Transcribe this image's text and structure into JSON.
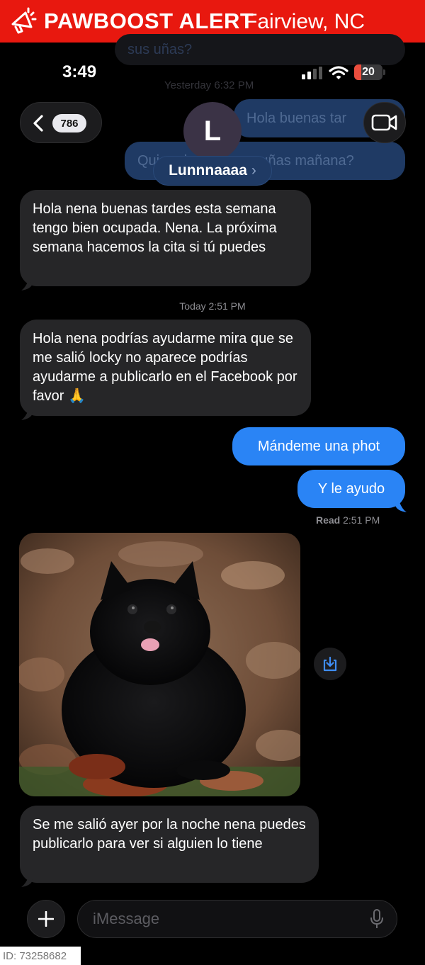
{
  "banner": {
    "brand": "PAWBOOST ALERT",
    "location": "Fairview, NC",
    "color": "#e8180f"
  },
  "ghost": {
    "top_bubble": "sus uñas?",
    "yesterday": "Yesterday 6:32 PM",
    "hola_bubble": "Hola buenas tar",
    "quiere_bubble": "Quiere hacerle sus uñas mañana?"
  },
  "status_bar": {
    "time": "3:49",
    "battery": "20"
  },
  "header": {
    "back_count": "786",
    "avatar_initial": "L",
    "contact_name": "Lunnnaaaa",
    "name_chevron": "›"
  },
  "messages": {
    "m1": "Hola nena buenas tardes esta semana tengo bien ocupada. Nena. La próxima semana hacemos la cita si tú puedes",
    "today_ts": "Today 2:51 PM",
    "m2": "Hola nena podrías ayudarme mira que se me salió locky  no aparece podrías ayudarme a publicarlo en el Facebook por favor 🙏",
    "m3": "Mándeme una phot",
    "m4": "Y le ayudo",
    "read_label": "Read",
    "read_time": "2:51 PM",
    "m5": "Se me salió ayer por la noche nena puedes publicarlo para ver si alguien lo tiene"
  },
  "input": {
    "placeholder": "iMessage"
  },
  "footer": {
    "id_label": "ID: 73258682"
  },
  "colors": {
    "outgoing": "#2a84f5",
    "incoming": "#262628",
    "background": "#000000"
  }
}
